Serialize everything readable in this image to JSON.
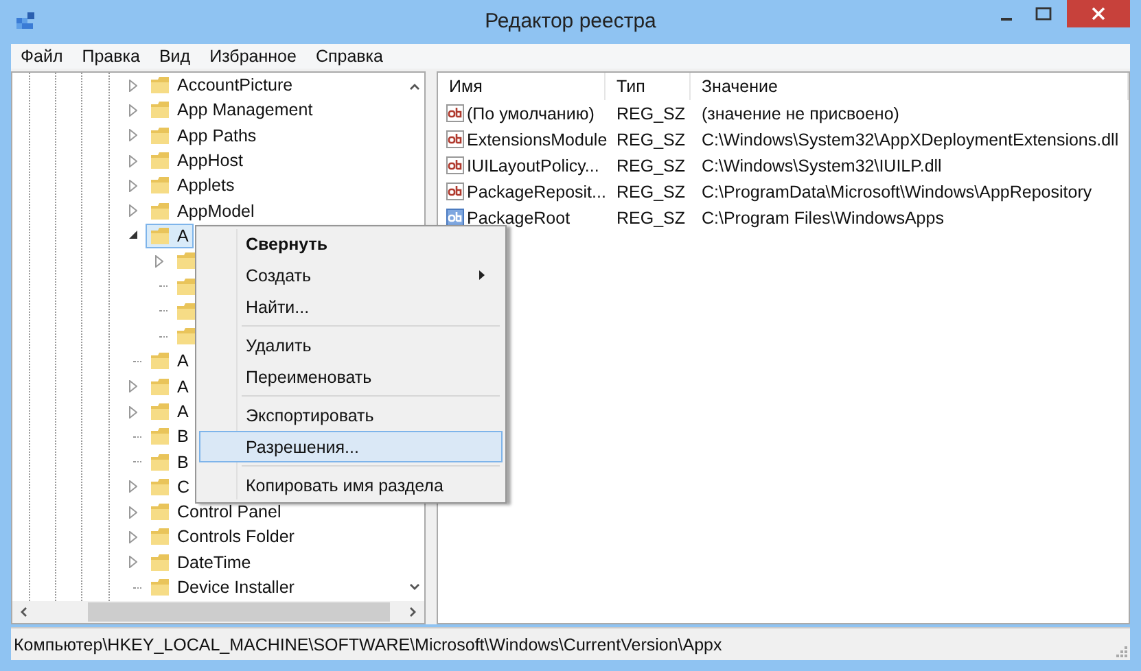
{
  "window": {
    "title": "Редактор реестра"
  },
  "menu": [
    "Файл",
    "Правка",
    "Вид",
    "Избранное",
    "Справка"
  ],
  "tree": [
    {
      "label": "AccountPicture",
      "expandable": true,
      "expanded": false,
      "selected": false
    },
    {
      "label": "App Management",
      "expandable": true,
      "expanded": false,
      "selected": false
    },
    {
      "label": "App Paths",
      "expandable": true,
      "expanded": false,
      "selected": false
    },
    {
      "label": "AppHost",
      "expandable": true,
      "expanded": false,
      "selected": false
    },
    {
      "label": "Applets",
      "expandable": true,
      "expanded": false,
      "selected": false
    },
    {
      "label": "AppModel",
      "expandable": true,
      "expanded": false,
      "selected": false
    },
    {
      "label": "A",
      "expandable": true,
      "expanded": true,
      "selected": true,
      "children": [
        {
          "expandable": true,
          "expanded": false,
          "selected": false
        },
        {
          "expandable": false,
          "selected": false
        },
        {
          "expandable": false,
          "selected": false
        },
        {
          "expandable": false,
          "selected": false
        }
      ]
    },
    {
      "label": "A",
      "expandable": false,
      "selected": false
    },
    {
      "label": "A",
      "expandable": true,
      "expanded": false,
      "selected": false
    },
    {
      "label": "A",
      "expandable": true,
      "expanded": false,
      "selected": false
    },
    {
      "label": "B",
      "expandable": false,
      "selected": false
    },
    {
      "label": "B",
      "expandable": false,
      "selected": false
    },
    {
      "label": "C",
      "expandable": true,
      "expanded": false,
      "selected": false
    },
    {
      "label": "Control Panel",
      "expandable": true,
      "expanded": false,
      "selected": false
    },
    {
      "label": "Controls Folder",
      "expandable": true,
      "expanded": false,
      "selected": false
    },
    {
      "label": "DateTime",
      "expandable": true,
      "expanded": false,
      "selected": false
    },
    {
      "label": "Device Installer",
      "expandable": false,
      "selected": false
    }
  ],
  "values": {
    "columns": [
      "Имя",
      "Тип",
      "Значение"
    ],
    "rows": [
      {
        "name": "(По умолчанию)",
        "type": "REG_SZ",
        "data": "(значение не присвоено)",
        "selected": false
      },
      {
        "name": "ExtensionsModule",
        "type": "REG_SZ",
        "data": "C:\\Windows\\System32\\AppXDeploymentExtensions.dll",
        "selected": false
      },
      {
        "name": "IUILayoutPolicy...",
        "type": "REG_SZ",
        "data": "C:\\Windows\\System32\\IUILP.dll",
        "selected": false
      },
      {
        "name": "PackageReposit...",
        "type": "REG_SZ",
        "data": "C:\\ProgramData\\Microsoft\\Windows\\AppRepository",
        "selected": false
      },
      {
        "name": "PackageRoot",
        "type": "REG_SZ",
        "data": "C:\\Program Files\\WindowsApps",
        "selected": true
      }
    ]
  },
  "context_menu": [
    {
      "kind": "item",
      "label": "Свернуть",
      "default": true,
      "submenu": false,
      "selected": false
    },
    {
      "kind": "item",
      "label": "Создать",
      "default": false,
      "submenu": true,
      "selected": false
    },
    {
      "kind": "item",
      "label": "Найти...",
      "default": false,
      "submenu": false,
      "selected": false
    },
    {
      "kind": "separator"
    },
    {
      "kind": "item",
      "label": "Удалить",
      "default": false,
      "submenu": false,
      "selected": false
    },
    {
      "kind": "item",
      "label": "Переименовать",
      "default": false,
      "submenu": false,
      "selected": false
    },
    {
      "kind": "separator"
    },
    {
      "kind": "item",
      "label": "Экспортировать",
      "default": false,
      "submenu": false,
      "selected": false
    },
    {
      "kind": "item",
      "label": "Разрешения...",
      "default": false,
      "submenu": false,
      "selected": true
    },
    {
      "kind": "separator"
    },
    {
      "kind": "item",
      "label": "Копировать имя раздела",
      "default": false,
      "submenu": false,
      "selected": false
    }
  ],
  "status_bar": "Компьютер\\HKEY_LOCAL_MACHINE\\SOFTWARE\\Microsoft\\Windows\\CurrentVersion\\Appx"
}
